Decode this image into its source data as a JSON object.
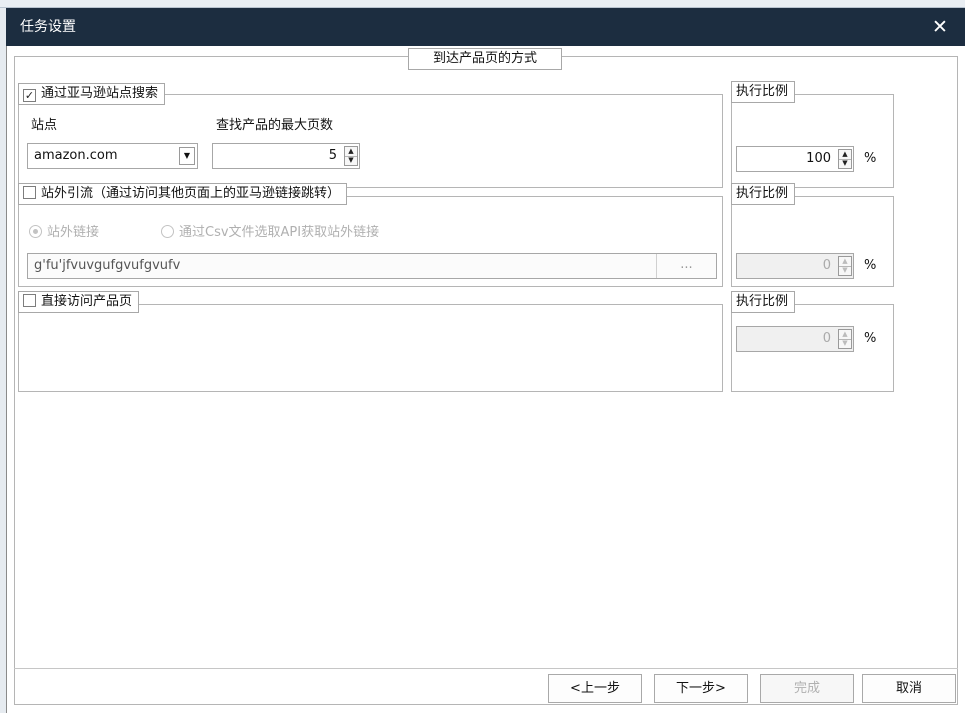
{
  "window": {
    "title": "任务设置",
    "close_glyph": "✕"
  },
  "main": {
    "legend": "到达产品页的方式"
  },
  "search": {
    "legend": "通过亚马逊站点搜索",
    "checked": true,
    "site_label": "站点",
    "site_value": "amazon.com",
    "max_pages_label": "查找产品的最大页数",
    "max_pages_value": "5",
    "ratio_legend": "执行比例",
    "ratio_value": "100",
    "ratio_unit": "%"
  },
  "offsite": {
    "legend": "站外引流（通过访问其他页面上的亚马逊链接跳转）",
    "checked": false,
    "radio_links": "站外链接",
    "radio_csv": "通过Csv文件选取API获取站外链接",
    "link_value": "g'fu'jfvuvgufgvufgvufv",
    "browse_label": "...",
    "ratio_legend": "执行比例",
    "ratio_value": "0",
    "ratio_unit": "%"
  },
  "direct": {
    "legend": "直接访问产品页",
    "checked": false,
    "ratio_legend": "执行比例",
    "ratio_value": "0",
    "ratio_unit": "%"
  },
  "buttons": {
    "prev": "<上一步",
    "next": "下一步>",
    "finish": "完成",
    "cancel": "取消"
  },
  "icons": {
    "dropdown": "▾",
    "spin_up": "▲",
    "spin_down": "▼",
    "check": "✓"
  }
}
